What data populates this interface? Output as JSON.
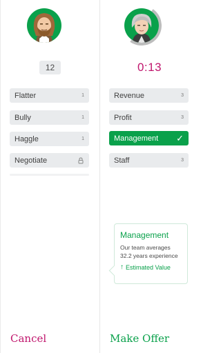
{
  "player": {
    "count": "12",
    "actions": [
      {
        "label": "Flatter",
        "count": "1",
        "locked": false
      },
      {
        "label": "Bully",
        "count": "1",
        "locked": false
      },
      {
        "label": "Haggle",
        "count": "1",
        "locked": false
      },
      {
        "label": "Negotiate",
        "count": "",
        "locked": true
      }
    ]
  },
  "opponent": {
    "timer": "0:13",
    "categories": [
      {
        "label": "Revenue",
        "count": "3",
        "selected": false
      },
      {
        "label": "Profit",
        "count": "3",
        "selected": false
      },
      {
        "label": "Management",
        "count": "",
        "selected": true
      },
      {
        "label": "Staff",
        "count": "3",
        "selected": false
      }
    ]
  },
  "info_card": {
    "title": "Management",
    "text": "Our team averages 32.2 years experience",
    "link": "Estimated Value"
  },
  "footer": {
    "cancel": "Cancel",
    "make_offer": "Make Offer"
  },
  "colors": {
    "green": "#0aa14b",
    "magenta": "#c0166d",
    "chip_gray": "#e9ebed"
  }
}
